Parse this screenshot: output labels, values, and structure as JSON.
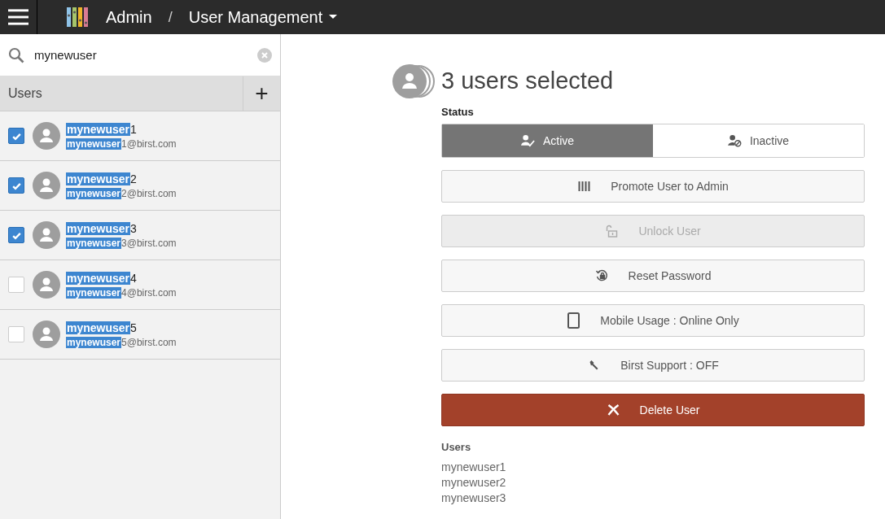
{
  "topbar": {
    "app": "Admin",
    "separator": "/",
    "page": "User Management"
  },
  "search": {
    "value": "mynewuser"
  },
  "users_header": {
    "title": "Users",
    "add": "+"
  },
  "users": [
    {
      "name_match": "mynewuser",
      "name_rest": "1",
      "email_match": "mynewuser",
      "email_rest": "1@birst.com",
      "checked": true
    },
    {
      "name_match": "mynewuser",
      "name_rest": "2",
      "email_match": "mynewuser",
      "email_rest": "2@birst.com",
      "checked": true
    },
    {
      "name_match": "mynewuser",
      "name_rest": "3",
      "email_match": "mynewuser",
      "email_rest": "3@birst.com",
      "checked": true
    },
    {
      "name_match": "mynewuser",
      "name_rest": "4",
      "email_match": "mynewuser",
      "email_rest": "4@birst.com",
      "checked": false
    },
    {
      "name_match": "mynewuser",
      "name_rest": "5",
      "email_match": "mynewuser",
      "email_rest": "5@birst.com",
      "checked": false
    }
  ],
  "detail": {
    "title": "3 users selected",
    "status_label": "Status",
    "status": [
      {
        "label": "Active",
        "kind": "active",
        "selected": true
      },
      {
        "label": "Inactive",
        "kind": "inactive",
        "selected": false
      }
    ],
    "actions": [
      {
        "label": "Promote User to Admin",
        "kind": "promote",
        "disabled": false
      },
      {
        "label": "Unlock User",
        "kind": "unlock",
        "disabled": true
      },
      {
        "label": "Reset Password",
        "kind": "reset",
        "disabled": false
      },
      {
        "label": "Mobile Usage : Online Only",
        "kind": "mobile",
        "disabled": false
      },
      {
        "label": "Birst Support : OFF",
        "kind": "support",
        "disabled": false
      },
      {
        "label": "Delete User",
        "kind": "delete",
        "disabled": false
      }
    ],
    "users_label": "Users",
    "selected_users": [
      "mynewuser1",
      "mynewuser2",
      "mynewuser3"
    ]
  }
}
